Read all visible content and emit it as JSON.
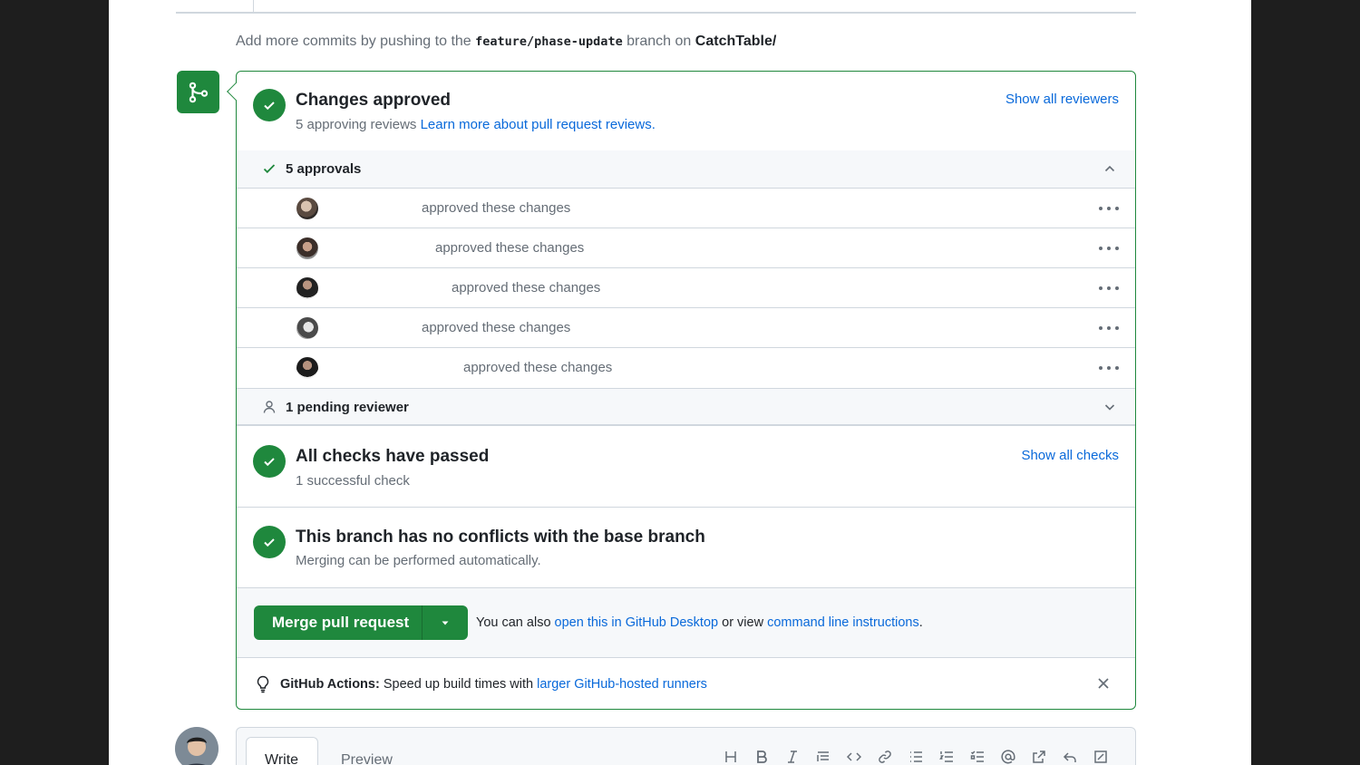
{
  "push_hint": {
    "prefix": "Add more commits by pushing to the",
    "branch": "feature/phase-update",
    "middle": "branch on",
    "repo": "CatchTable/"
  },
  "review": {
    "title": "Changes approved",
    "subtitle": "5 approving reviews",
    "learn_link": "Learn more about pull request reviews.",
    "show_all": "Show all reviewers",
    "approvals_label": "5 approvals",
    "approvals": [
      {
        "text": "approved these changes"
      },
      {
        "text": "approved these changes"
      },
      {
        "text": "approved these changes"
      },
      {
        "text": "approved these changes"
      },
      {
        "text": "approved these changes"
      }
    ],
    "pending_label": "1 pending reviewer"
  },
  "checks": {
    "title": "All checks have passed",
    "subtitle": "1 successful check",
    "show_all": "Show all checks"
  },
  "conflicts": {
    "title": "This branch has no conflicts with the base branch",
    "subtitle": "Merging can be performed automatically."
  },
  "merge": {
    "button_label": "Merge pull request",
    "also_prefix": "You can also",
    "desktop_link": "open this in GitHub Desktop",
    "or_view": "or view",
    "cli_link": "command line instructions",
    "period": "."
  },
  "actions_tip": {
    "label": "GitHub Actions:",
    "text": "Speed up build times with",
    "link": "larger GitHub-hosted runners"
  },
  "editor": {
    "write_tab": "Write",
    "preview_tab": "Preview"
  },
  "colors": {
    "success": "#1f883d",
    "link": "#0969da",
    "muted": "#656d76",
    "border": "#d0d7de"
  }
}
